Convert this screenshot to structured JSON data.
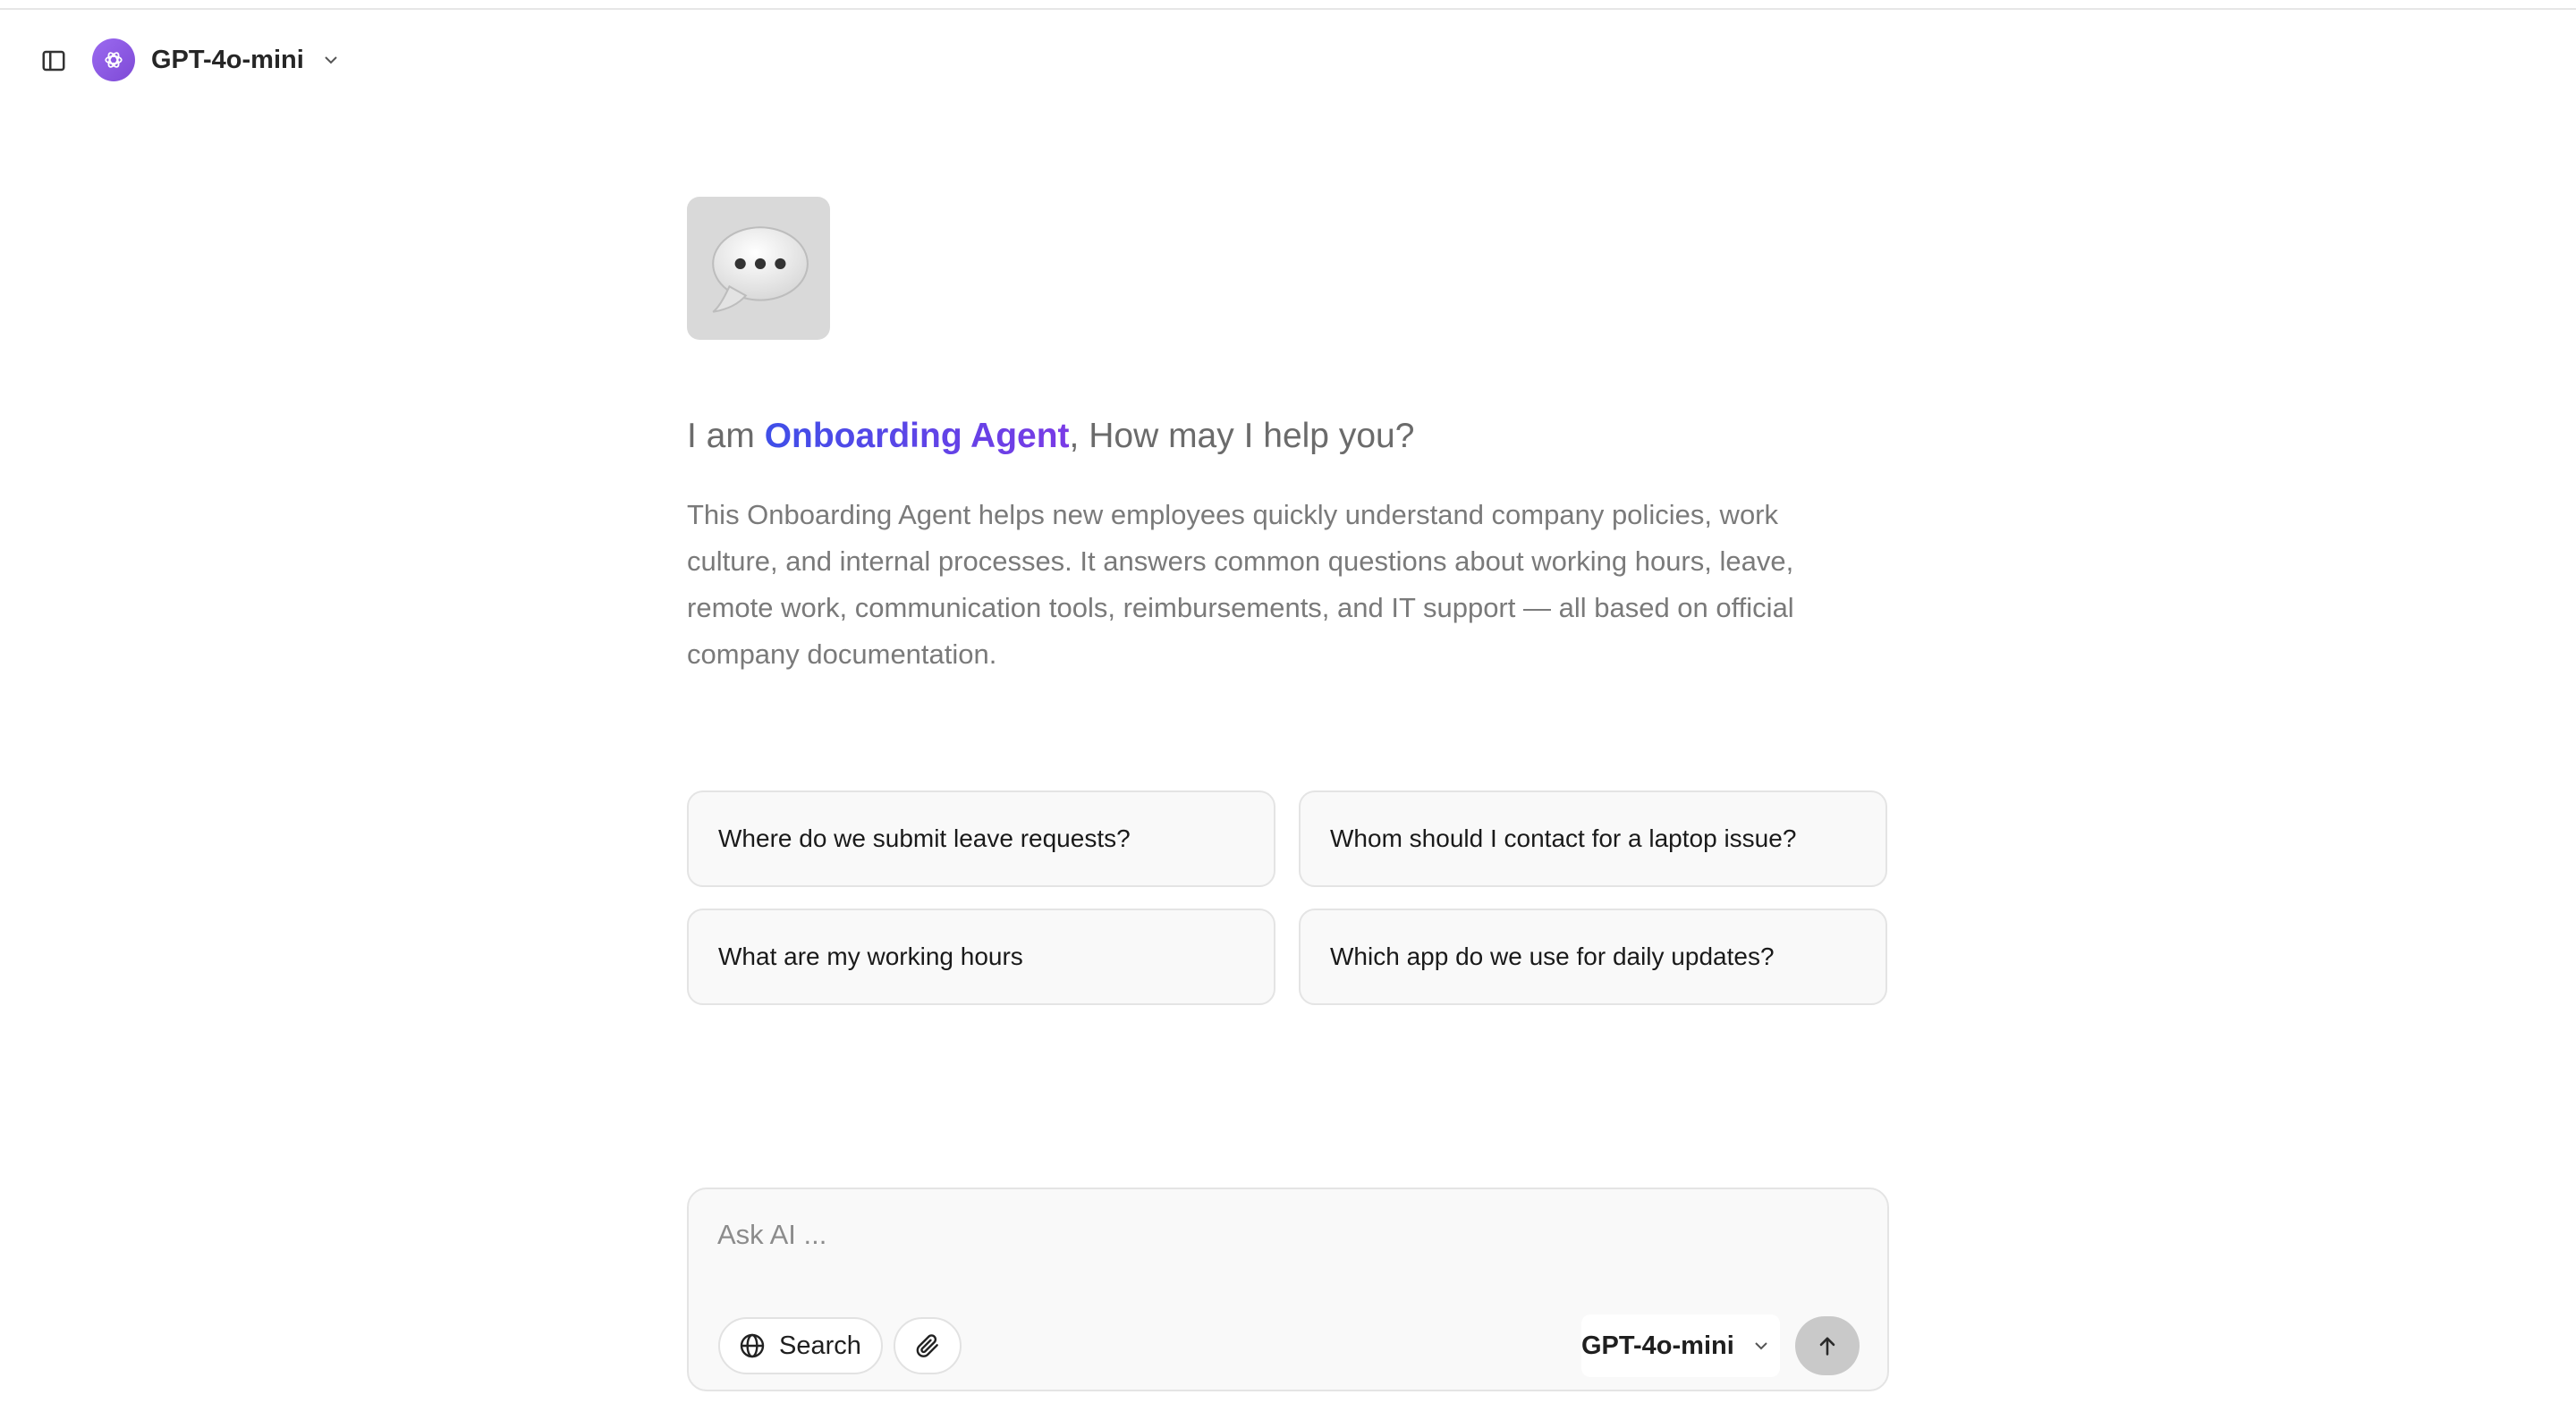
{
  "header": {
    "model_name": "GPT-4o-mini"
  },
  "agent": {
    "headline_prefix": "I am ",
    "name": "Onboarding Agent",
    "headline_suffix": ", How may I help you?",
    "description": "This Onboarding Agent helps new employees quickly understand company policies, work culture, and internal processes. It answers common questions about working hours, leave, remote work, communication tools, reimbursements, and IT support — all based on official company documentation."
  },
  "suggestions": [
    {
      "label": "Where do we submit leave requests?"
    },
    {
      "label": "Whom should I contact for a laptop issue?"
    },
    {
      "label": "What are my working hours"
    },
    {
      "label": "Which app do we use for daily updates?"
    }
  ],
  "composer": {
    "placeholder": "Ask AI ...",
    "search_label": "Search",
    "model_name": "GPT-4o-mini"
  },
  "icons": {
    "sidebar_toggle": "sidebar-toggle-icon",
    "model_logo": "openai-logo-icon",
    "chevron": "chevron-down-icon",
    "avatar": "speech-bubble-icon",
    "globe": "globe-icon",
    "paperclip": "paperclip-icon",
    "send": "arrow-up-icon"
  },
  "colors": {
    "accent_gradient_start": "#3f4fe8",
    "accent_gradient_end": "#7a3be6",
    "model_logo": "#8b5be8"
  }
}
